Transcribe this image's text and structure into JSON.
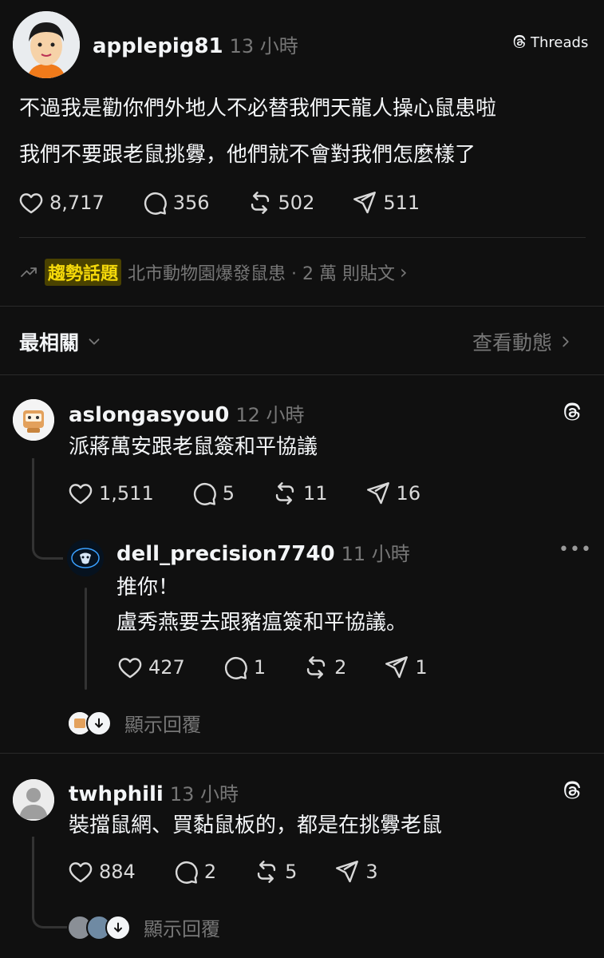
{
  "post": {
    "username": "applepig81",
    "time": "13 小時",
    "brand": "Threads",
    "lines": [
      "不過我是勸你們外地人不必替我們天龍人操心鼠患啦",
      "我們不要跟老鼠挑釁，他們就不會對我們怎麼樣了"
    ],
    "likes": "8,717",
    "comments": "356",
    "reposts": "502",
    "shares": "511"
  },
  "trending": {
    "badge": "趨勢話題",
    "text": "北市動物園爆發鼠患 · 2 萬 則貼文"
  },
  "sort": {
    "label": "最相關",
    "activity": "查看動態"
  },
  "replies": [
    {
      "username": "aslongasyou0",
      "time": "12 小時",
      "text": "派蔣萬安跟老鼠簽和平協議",
      "likes": "1,511",
      "comments": "5",
      "reposts": "11",
      "shares": "16"
    },
    {
      "username": "dell_precision7740",
      "time": "11 小時",
      "lines": [
        "推你！",
        "盧秀燕要去跟豬瘟簽和平協議。"
      ],
      "likes": "427",
      "comments": "1",
      "reposts": "2",
      "shares": "1"
    },
    {
      "username": "twhphili",
      "time": "13 小時",
      "text": "裝擋鼠網、買黏鼠板的，都是在挑釁老鼠",
      "likes": "884",
      "comments": "2",
      "reposts": "5",
      "shares": "3"
    }
  ],
  "show_replies_label": "顯示回覆",
  "colors": {
    "background": "#101010",
    "text": "#f3f5f7",
    "muted": "#777777",
    "trend_highlight": "#f5d90a"
  }
}
